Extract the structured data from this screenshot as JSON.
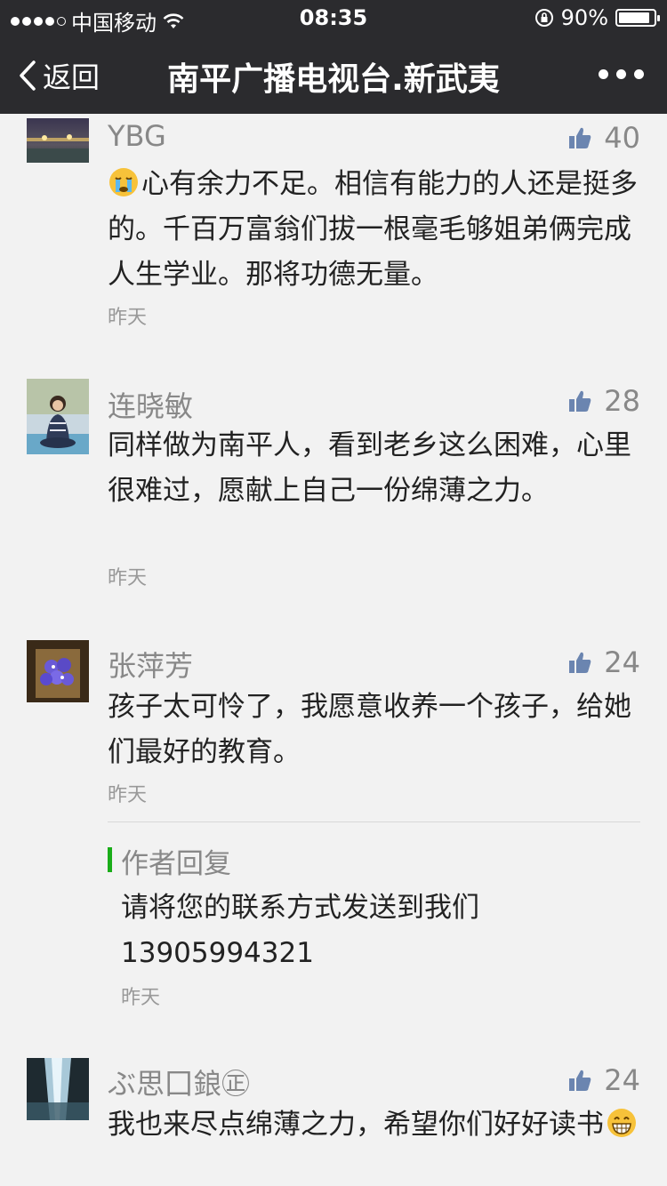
{
  "status_bar": {
    "carrier": "中国移动",
    "time": "08:35",
    "battery": "90%",
    "battery_level": 0.9
  },
  "nav": {
    "back_label": "返回",
    "title": "南平广播电视台.新武夷"
  },
  "comments": [
    {
      "name": "YBG",
      "likes": "40",
      "text": "心有余力不足。相信有能力的人还是挺多的。千百万富翁们拔一根毫毛够姐弟俩完成人生学业。那将功德无量。",
      "time": "昨天"
    },
    {
      "name": "连晓敏",
      "likes": "28",
      "text": "同样做为南平人，看到老乡这么困难，心里很难过，愿献上自己一份绵薄之力。",
      "time": "昨天"
    },
    {
      "name": "张萍芳",
      "likes": "24",
      "text": "孩子太可怜了，我愿意收养一个孩子，给她们最好的教育。",
      "time": "昨天",
      "reply": {
        "label": "作者回复",
        "text": "请将您的联系方式发送到我们13905994321",
        "time": "昨天"
      }
    },
    {
      "name": "ぶ思囗鋃㊣",
      "likes": "24",
      "text": "我也来尽点绵薄之力，希望你们好好读书",
      "time": ""
    }
  ]
}
